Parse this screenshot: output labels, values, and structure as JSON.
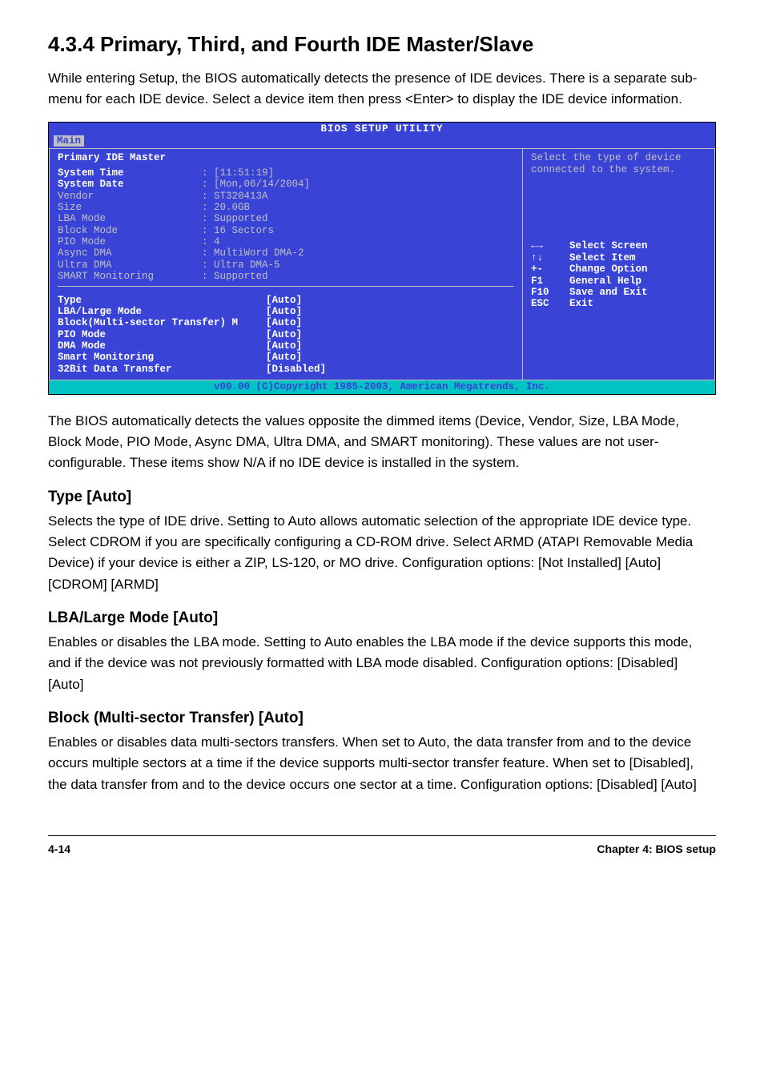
{
  "section_title": "4.3.4   Primary, Third, and Fourth IDE Master/Slave",
  "intro_text": "While entering Setup, the BIOS automatically detects the presence of IDE devices. There is a separate sub-menu for each IDE device. Select a device item then press <Enter> to display the IDE device information.",
  "bios": {
    "titlebar": "BIOS SETUP UTILITY",
    "active_tab": "Main",
    "panel_title": "Primary IDE Master",
    "info_rows": [
      {
        "label": "System Time",
        "value": ": [11:51:19]",
        "head": true
      },
      {
        "label": "System Date",
        "value": ": [Mon,06/14/2004]",
        "head": true
      },
      {
        "label": "Vendor",
        "value": ": ST320413A"
      },
      {
        "label": "Size",
        "value": ": 20.0GB"
      },
      {
        "label": "LBA Mode",
        "value": ": Supported"
      },
      {
        "label": "Block Mode",
        "value": ": 16 Sectors"
      },
      {
        "label": "PIO Mode",
        "value": ": 4"
      },
      {
        "label": "Async DMA",
        "value": ": MultiWord DMA-2"
      },
      {
        "label": "Ultra DMA",
        "value": ": Ultra DMA-5"
      },
      {
        "label": "SMART Monitoring",
        "value": ": Supported"
      }
    ],
    "settings_rows": [
      {
        "label": "Type",
        "value": "[Auto]"
      },
      {
        "label": "LBA/Large Mode",
        "value": "[Auto]"
      },
      {
        "label": "Block(Multi-sector Transfer) M",
        "value": "[Auto]"
      },
      {
        "label": "PIO Mode",
        "value": "[Auto]"
      },
      {
        "label": "DMA Mode",
        "value": "[Auto]"
      },
      {
        "label": "Smart Monitoring",
        "value": "[Auto]"
      },
      {
        "label": "32Bit Data Transfer",
        "value": "[Disabled]"
      }
    ],
    "right_help": "Select the type of device connected to the system.",
    "legend": [
      {
        "key": "←→",
        "label": "Select Screen"
      },
      {
        "key": "↑↓",
        "label": "Select Item"
      },
      {
        "key": "+-",
        "label": "Change Option"
      },
      {
        "key": "F1",
        "label": "General Help"
      },
      {
        "key": "F10",
        "label": "Save and Exit"
      },
      {
        "key": "ESC",
        "label": "Exit"
      }
    ],
    "copyright": "v00.00 (C)Copyright 1985-2003, American Megatrends, Inc."
  },
  "mid_text": "The BIOS automatically detects the values opposite the dimmed items (Device, Vendor, Size, LBA Mode, Block Mode, PIO Mode, Async DMA, Ultra DMA, and SMART monitoring). These values are not user-configurable. These items show N/A if no IDE device is installed in the system.",
  "type_heading": "Type [Auto]",
  "type_text": "Selects the type of IDE drive. Setting to Auto allows automatic selection of the appropriate IDE device type. Select CDROM if you are specifically configuring a CD-ROM drive. Select ARMD (ATAPI Removable Media Device) if your device is either a ZIP, LS-120, or MO drive. Configuration options: [Not Installed] [Auto] [CDROM] [ARMD]",
  "lba_heading": "LBA/Large Mode [Auto]",
  "lba_text": "Enables or disables the LBA mode. Setting to Auto enables the LBA mode if the device supports this mode, and if the device was not previously formatted with LBA mode disabled. Configuration options: [Disabled] [Auto]",
  "block_heading": "Block (Multi-sector Transfer) [Auto]",
  "block_text": "Enables or disables data multi-sectors transfers. When set to Auto, the data transfer from and to the device occurs multiple sectors at a time if the device supports multi-sector transfer feature. When set to [Disabled], the data transfer from and to the device occurs one sector at a time. Configuration options: [Disabled] [Auto]",
  "footer_left": "4-14",
  "footer_right": "Chapter 4: BIOS setup"
}
